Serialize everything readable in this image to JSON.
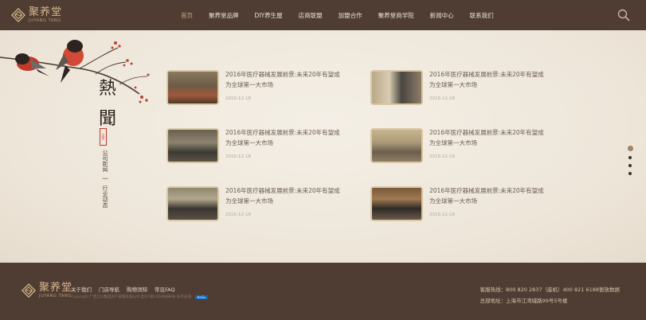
{
  "brand": {
    "cn": "聚养堂",
    "en": "JUYANG TANG"
  },
  "nav": [
    "首页",
    "聚养堂品牌",
    "DIY养生屋",
    "店商联盟",
    "加盟合作",
    "聚养堂商学院",
    "新闻中心",
    "联系我们"
  ],
  "section": {
    "title": "熱聞",
    "seal": "文字",
    "subnav": [
      "公司新闻",
      "行业动态"
    ]
  },
  "news": [
    {
      "title": "2016年医疗器械发展前景:未来20年有望成为全球第一大市场",
      "date": "2016-12-18"
    },
    {
      "title": "2016年医疗器械发展前景:未来20年有望成为全球第一大市场",
      "date": "2016-12-18"
    },
    {
      "title": "2016年医疗器械发展前景:未来20年有望成为全球第一大市场",
      "date": "2016-12-18"
    },
    {
      "title": "2016年医疗器械发展前景:未来20年有望成为全球第一大市场",
      "date": "2016-12-18"
    },
    {
      "title": "2016年医疗器械发展前景:未来20年有望成为全球第一大市场",
      "date": "2016-12-18"
    },
    {
      "title": "2016年医疗器械发展前景:未来20年有望成为全球第一大市场",
      "date": "2016-12-18"
    }
  ],
  "footer": {
    "links": [
      "关于我们",
      "门店导航",
      "购物须知",
      "常见FAQ"
    ],
    "copyright": "Copyright 广西江川集团房产管理有限公司   桂ICP备16048888号   技术支持:",
    "badge": "HeGu",
    "hotline": "客服热线：800 820 2837（座机）400 821 6188暂放数据",
    "address": "总部地址：上海市江湾城路99号5号楼"
  },
  "colors": {
    "header_bg": "#4f3d34",
    "accent": "#c9a57b",
    "paper": "#efe8dc",
    "seal_red": "#c0392b"
  }
}
